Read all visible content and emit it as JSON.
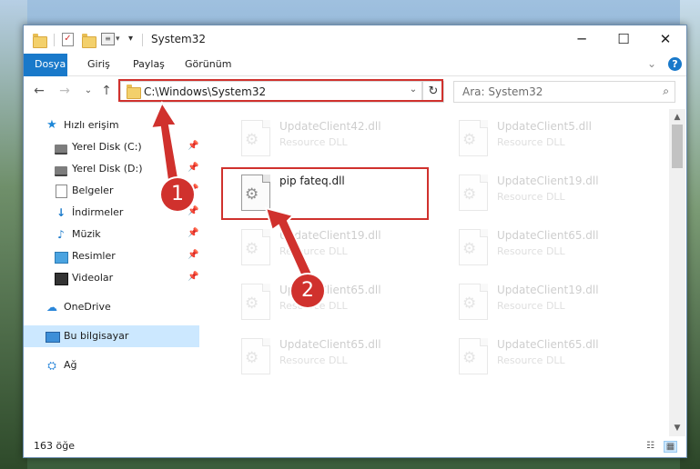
{
  "window": {
    "title": "System32",
    "controls": {
      "minimize": "─",
      "maximize": "☐",
      "close": "✕"
    }
  },
  "ribbon": {
    "tabs": [
      "Dosya",
      "Giriş",
      "Paylaş",
      "Görünüm"
    ],
    "collapse_glyph": "⌄",
    "help_glyph": "?"
  },
  "nav": {
    "back": "←",
    "forward": "→",
    "recent": "⌄",
    "up": "↑",
    "address": "C:\\Windows\\System32",
    "address_dropdown": "⌄",
    "refresh": "↻",
    "search_placeholder": "Ara: System32",
    "search_glyph": "⌕"
  },
  "sidebar": {
    "quick_access": {
      "label": "Hızlı erişim",
      "icon": "star-icon"
    },
    "pinned": [
      {
        "label": "Yerel Disk (C:)",
        "icon": "disk-icon"
      },
      {
        "label": "Yerel Disk (D:)",
        "icon": "disk-icon"
      },
      {
        "label": "Belgeler",
        "icon": "documents-icon"
      },
      {
        "label": "İndirmeler",
        "icon": "downloads-icon"
      },
      {
        "label": "Müzik",
        "icon": "music-icon"
      },
      {
        "label": "Resimler",
        "icon": "pictures-icon"
      },
      {
        "label": "Videolar",
        "icon": "videos-icon"
      }
    ],
    "onedrive": {
      "label": "OneDrive",
      "icon": "cloud-icon"
    },
    "this_pc": {
      "label": "Bu bilgisayar",
      "icon": "computer-icon",
      "selected": true
    },
    "network": {
      "label": "Ağ",
      "icon": "network-icon"
    }
  },
  "files": [
    {
      "name": "UpdateClient42.dll",
      "type": "Resource DLL",
      "faded": true
    },
    {
      "name": "UpdateClient5.dll",
      "type": "Resource DLL",
      "faded": true
    },
    {
      "name": "pip fateq.dll",
      "type": "",
      "faded": false
    },
    {
      "name": "UpdateClient19.dll",
      "type": "Resource DLL",
      "faded": true
    },
    {
      "name": "UpdateClient19.dll",
      "type": "Resource DLL",
      "faded": true
    },
    {
      "name": "UpdateClient65.dll",
      "type": "Resource DLL",
      "faded": true
    },
    {
      "name": "UpdateClient65.dll",
      "type": "Resource DLL",
      "faded": true
    },
    {
      "name": "UpdateClient19.dll",
      "type": "Resource DLL",
      "faded": true
    },
    {
      "name": "UpdateClient65.dll",
      "type": "Resource DLL",
      "faded": true
    },
    {
      "name": "UpdateClient65.dll",
      "type": "Resource DLL",
      "faded": true
    }
  ],
  "status": {
    "item_count": "163 öğe"
  },
  "annotations": {
    "step1": "1",
    "step2": "2",
    "highlight_color": "#d0312d"
  },
  "colors": {
    "accent": "#1979ca",
    "selection": "#cce8ff"
  }
}
